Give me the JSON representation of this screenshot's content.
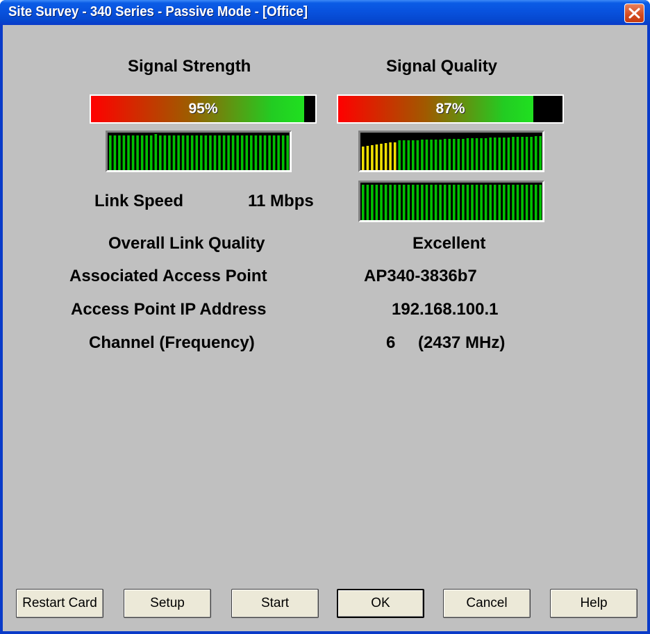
{
  "window": {
    "title": "Site Survey - 340 Series - Passive Mode - [Office]"
  },
  "signal_strength": {
    "heading": "Signal Strength",
    "percent_label": "95%",
    "level": 0.95
  },
  "signal_quality": {
    "heading": "Signal Quality",
    "percent_label": "87%",
    "level": 0.87
  },
  "link_speed": {
    "label": "Link Speed",
    "value": "11 Mbps"
  },
  "info": {
    "overall_link_quality": {
      "label": "Overall Link Quality",
      "value": "Excellent"
    },
    "associated_ap": {
      "label": "Associated Access Point",
      "value": "AP340-3836b7"
    },
    "ap_ip": {
      "label": "Access Point IP Address",
      "value": "192.168.100.1"
    },
    "channel": {
      "label": "Channel (Frequency)",
      "channel": "6",
      "frequency": "(2437 MHz)"
    }
  },
  "buttons": {
    "restart_card": "Restart Card",
    "setup": "Setup",
    "start": "Start",
    "ok": "OK",
    "cancel": "Cancel",
    "help": "Help"
  },
  "colors": {
    "graph_bar": "#00c000",
    "graph_warn_bar": "#f0e000",
    "graph_bg": "#000000",
    "title_bar": "#0852de"
  }
}
